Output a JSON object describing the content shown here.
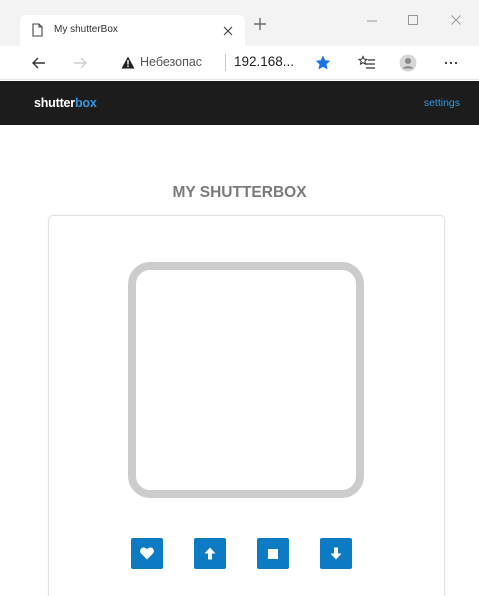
{
  "browser": {
    "tab_title": "My shutterBox",
    "address_status": "Небезопас",
    "address_url": "192.168..."
  },
  "nav": {
    "brand_primary": "shutter",
    "brand_accent": "box",
    "settings_label": "settings"
  },
  "main": {
    "title": "MY SHUTTERBOX"
  },
  "colors": {
    "navbar_bg": "#1c1c1c",
    "accent": "#3598db",
    "button_bg": "#0d7bc4",
    "frame": "#cccccc"
  },
  "controls": {
    "buttons": [
      {
        "icon": "heart-icon"
      },
      {
        "icon": "arrow-up-icon"
      },
      {
        "icon": "stop-icon"
      },
      {
        "icon": "arrow-down-icon"
      }
    ]
  }
}
